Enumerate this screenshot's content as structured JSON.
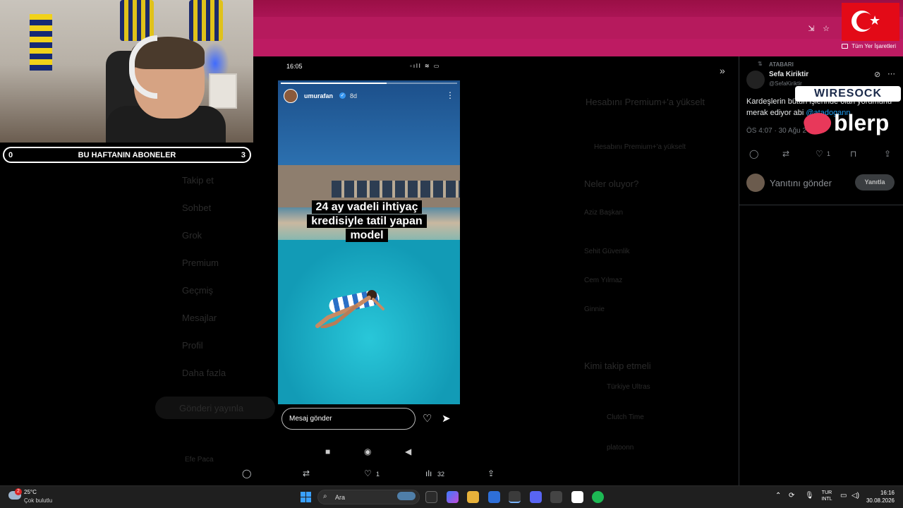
{
  "browser": {
    "bookmarks_all": "Tüm Yer İşaretleri"
  },
  "webcam": {
    "subs_left": "0",
    "subs_title": "BU HAFTANIN ABONELER",
    "subs_right": "3"
  },
  "phone": {
    "time": "16:05",
    "story_user": "umurafan",
    "story_age": "8d",
    "caption": "24 ay vadeli ihtiyaç kredisiyle tatil yapan model",
    "message_placeholder": "Mesaj gönder",
    "progress_fraction": 0.6
  },
  "tweet": {
    "context": "ATABARI",
    "author": "Sefa Kiriktir",
    "handle": "@SefaKiriktir",
    "text": "Kardeşlerin bütün işlerinde olan yorumunu merak ediyor abi ",
    "mention": "@atadogann",
    "meta": "ÖS 4:07 · 30 Ağu 2",
    "like_count": "1",
    "reply_placeholder": "Yanıtını gönder",
    "reply_button": "Yanıtla"
  },
  "overlays": {
    "wiresock": "WIRESOCK",
    "blerp": "blerp"
  },
  "bottom_actions": {
    "likes": "1",
    "views": "32"
  },
  "taskbar": {
    "temp": "25°C",
    "weather": "Çok bulutlu",
    "weather_badge": "2",
    "search_placeholder": "Ara",
    "lang_top": "TUR",
    "lang_bottom": "INTL",
    "time": "16:16",
    "date": "30.08.2026"
  },
  "background_twitter": {
    "premium_title": "Hesabını Premium+'a yükselt",
    "premium_button": "Hesabını Premium+'a yükselt",
    "whats_happening": "Neler oluyor?",
    "trends": [
      "Aziz Başkan",
      "Sehit Güvenlik",
      "Cem Yılmaz",
      "Ginnie"
    ],
    "who_to_follow": "Kimi takip etmeli",
    "follow_suggestions": [
      "Türkiye Ultras",
      "Clutch Time",
      "platoonn"
    ],
    "nav": [
      "Takip et",
      "Sohbet",
      "Grok",
      "Premium",
      "Geçmiş",
      "Mesajlar",
      "Profil",
      "Daha fazla"
    ],
    "post_button": "Gönderi yayınla",
    "profile_name": "Efe Paca"
  },
  "colors": {
    "browser_accent": "#b0165a",
    "link": "#1d9bf0",
    "flag_red": "#e30a17"
  }
}
